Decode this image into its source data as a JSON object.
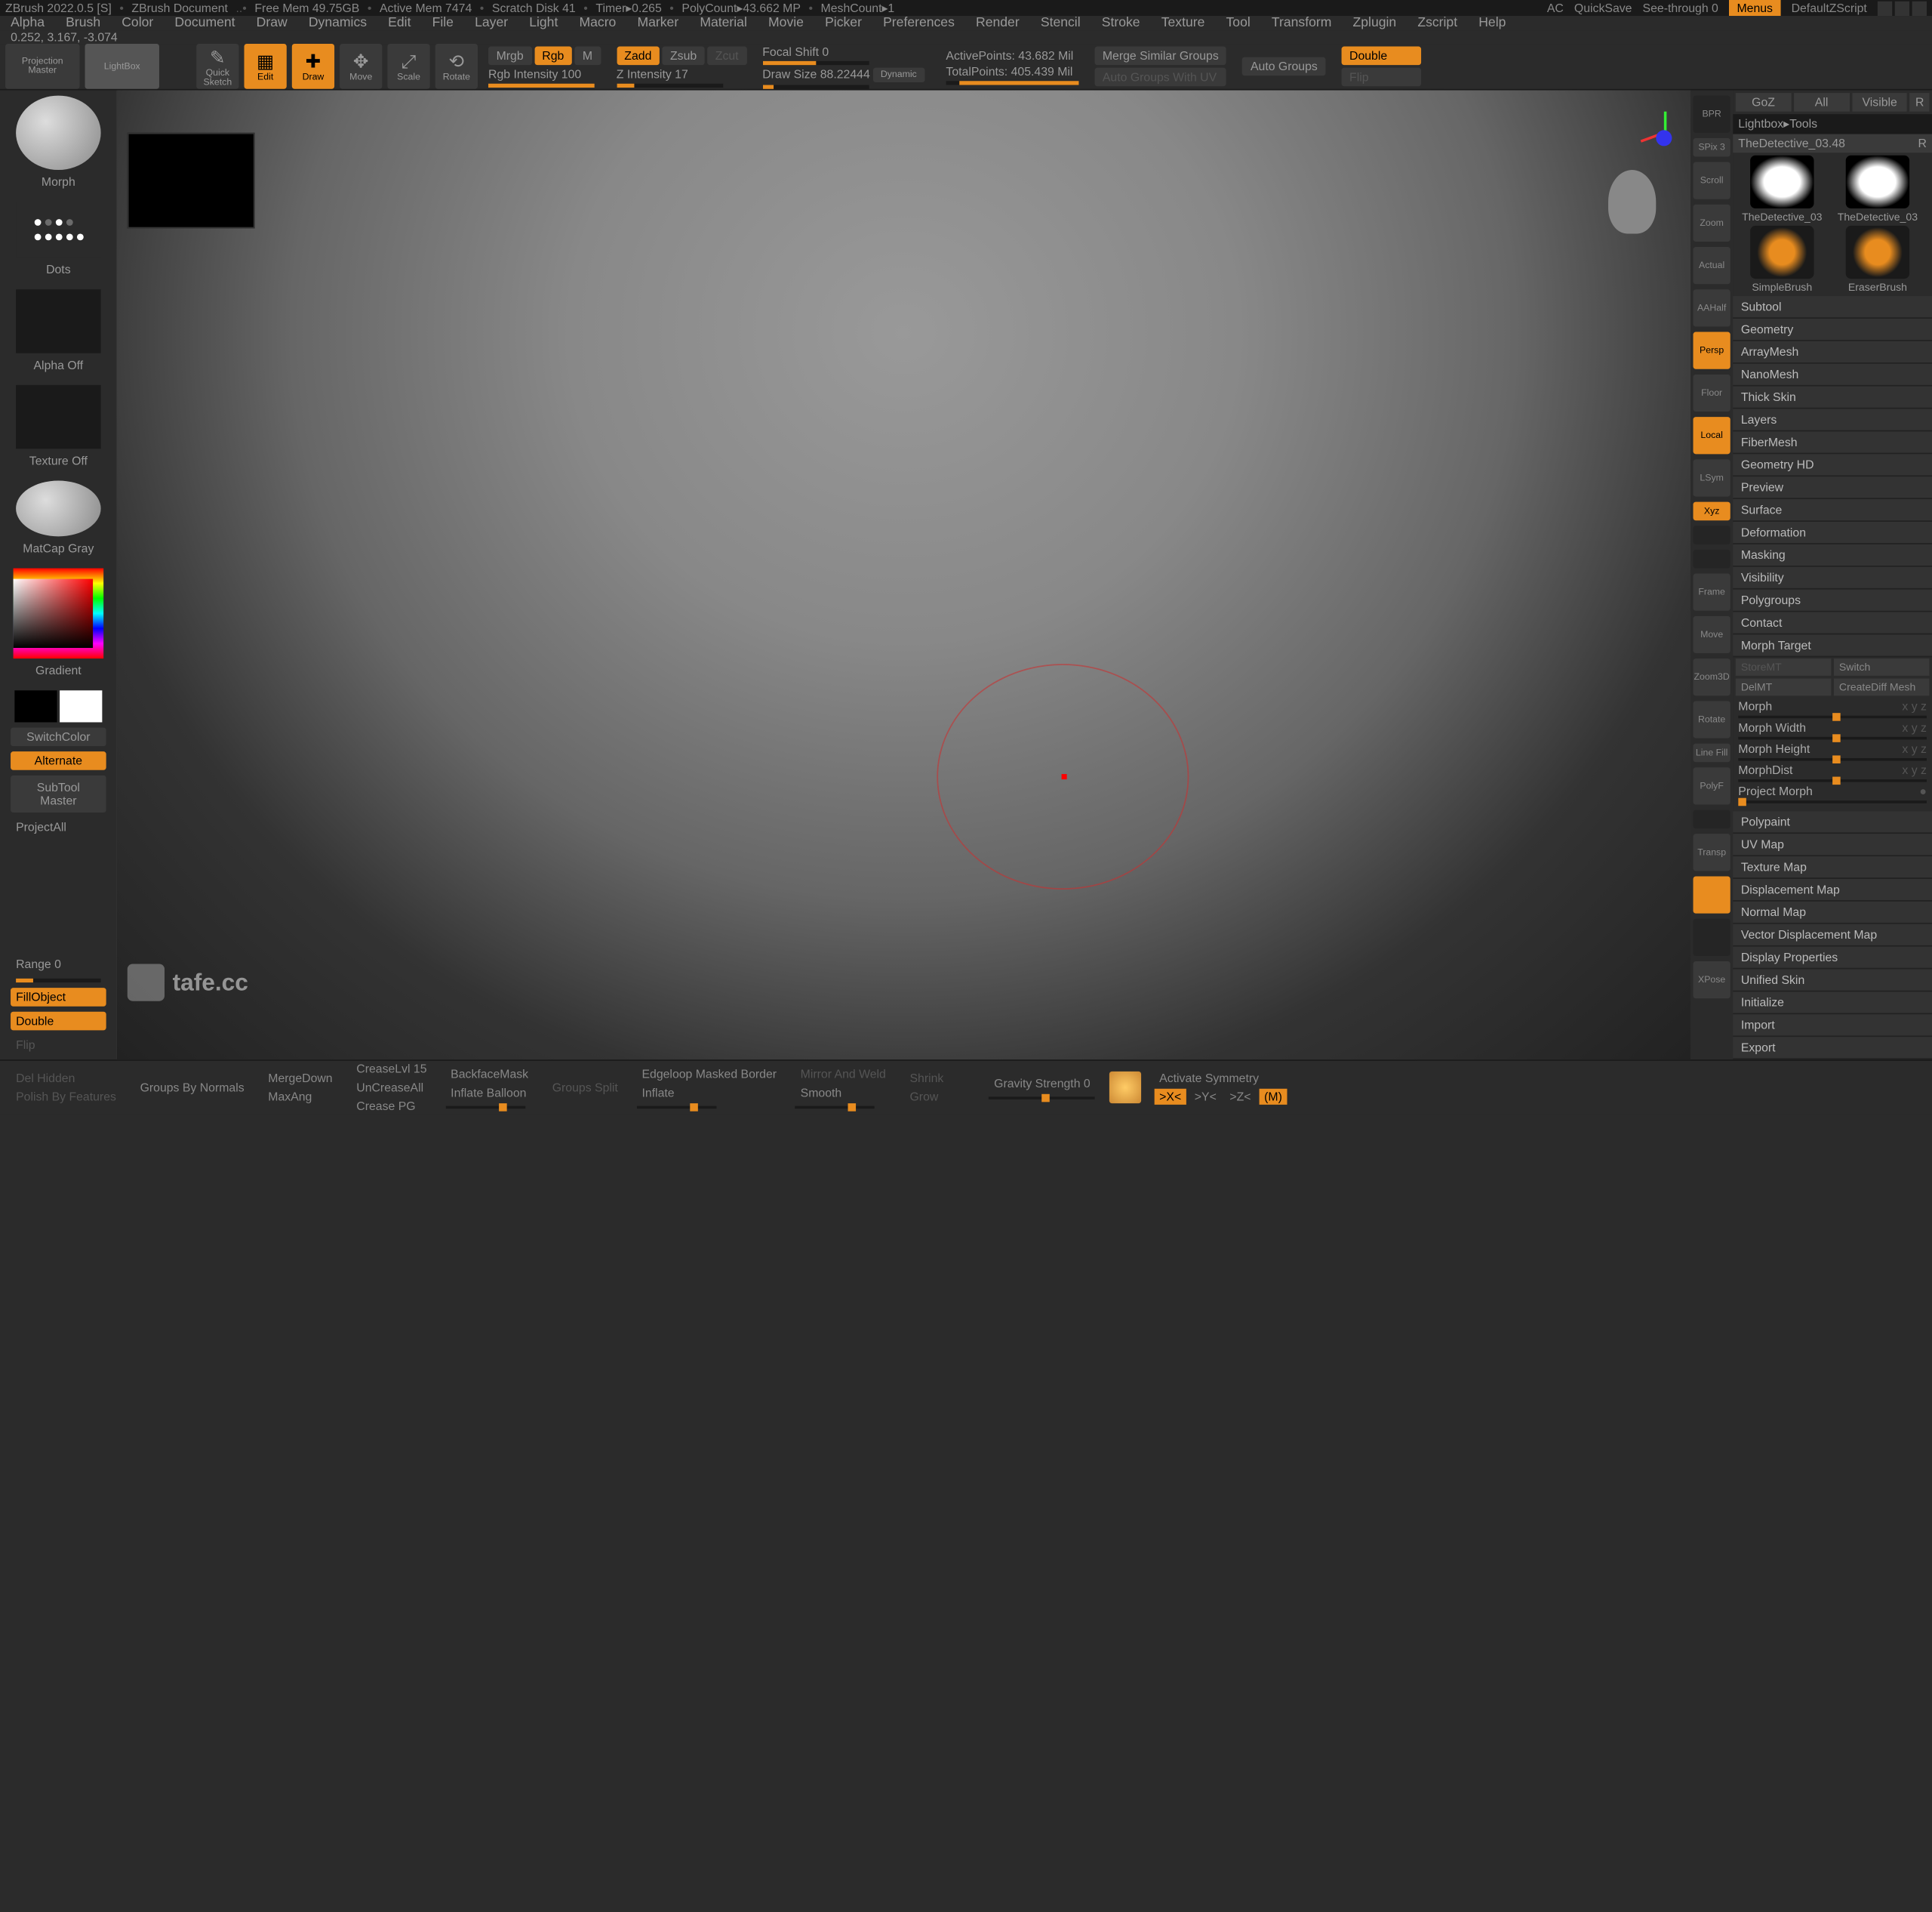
{
  "title": {
    "app": "ZBrush 2022.0.5 [S]",
    "doc": "ZBrush Document",
    "mem": "Free Mem 49.75GB",
    "active": "Active Mem 7474",
    "scratch": "Scratch Disk 41",
    "timer": "Timer▸0.265",
    "polycount": "PolyCount▸43.662 MP",
    "meshcount": "MeshCount▸1",
    "ac": "AC",
    "quicksave": "QuickSave",
    "seethrough": "See-through  0",
    "menus": "Menus",
    "zscript": "DefaultZScript"
  },
  "menubar": [
    "Alpha",
    "Brush",
    "Color",
    "Document",
    "Draw",
    "Dynamics",
    "Edit",
    "File",
    "Layer",
    "Light",
    "Macro",
    "Marker",
    "Material",
    "Movie",
    "Picker",
    "Preferences",
    "Render",
    "Stencil",
    "Stroke",
    "Texture",
    "Tool",
    "Transform",
    "Zplugin",
    "Zscript",
    "Help"
  ],
  "status_coords": "0.252, 3.167, -3.074",
  "toolbar": {
    "projection": "Projection\nMaster",
    "lightbox": "LightBox",
    "quicksketch": "Quick\nSketch",
    "edit": "Edit",
    "draw": "Draw",
    "move": "Move",
    "scale": "Scale",
    "rotate": "Rotate",
    "mrgb": "Mrgb",
    "rgb": "Rgb",
    "m": "M",
    "zadd": "Zadd",
    "zsub": "Zsub",
    "zcut": "Zcut",
    "rgb_intensity": "Rgb Intensity 100",
    "z_intensity": "Z Intensity 17",
    "focal_shift": "Focal Shift 0",
    "draw_size": "Draw Size 88.22444",
    "dynamic": "Dynamic",
    "active_points": "ActivePoints: 43.682 Mil",
    "total_points": "TotalPoints: 405.439 Mil",
    "merge_groups": "Merge Similar Groups",
    "auto_uv": "Auto Groups With UV",
    "auto_groups": "Auto Groups",
    "double": "Double",
    "flip": "Flip"
  },
  "left": {
    "morph": "Morph",
    "dots": "Dots",
    "alpha_off": "Alpha Off",
    "texture_off": "Texture Off",
    "matcap": "MatCap Gray",
    "gradient": "Gradient",
    "switch": "SwitchColor",
    "alternate": "Alternate",
    "subtool": "SubTool\nMaster",
    "projectall": "ProjectAll",
    "range": "Range 0",
    "fillobject": "FillObject",
    "double2": "Double",
    "flip2": "Flip"
  },
  "righttools": [
    "BPR",
    "SPix 3",
    "Scroll",
    "Zoom",
    "Actual",
    "AAHalf",
    "Persp",
    "Floor",
    "Local",
    "LSym",
    "Xyz",
    "",
    "",
    "Frame",
    "Move",
    "Zoom3D",
    "Rotate",
    "Line Fill",
    "PolyF",
    "",
    "Transp",
    "",
    "",
    "XPose"
  ],
  "rp": {
    "tabs": [
      "GoZ",
      "All",
      "Visible",
      "R"
    ],
    "breadcrumb": "Lightbox▸Tools",
    "toolname": "TheDetective_03.48",
    "r": "R",
    "thumbs": [
      "TheDetective_03",
      "TheDetective_03",
      "SimpleBrush",
      "EraserBrush"
    ],
    "sections": [
      "Subtool",
      "Geometry",
      "ArrayMesh",
      "NanoMesh",
      "Thick Skin",
      "Layers",
      "FiberMesh",
      "Geometry HD",
      "Preview",
      "Surface",
      "Deformation",
      "Masking",
      "Visibility",
      "Polygroups",
      "Contact",
      "Morph Target"
    ],
    "morph_buttons": {
      "storemt": "StoreMT",
      "switch": "Switch",
      "delmt": "DelMT",
      "creatediff": "CreateDiff Mesh"
    },
    "morph_sliders": [
      "Morph",
      "Morph Width",
      "Morph Height",
      "MorphDist",
      "Project Morph"
    ],
    "sections2": [
      "Polypaint",
      "UV Map",
      "Texture Map",
      "Displacement Map",
      "Normal Map",
      "Vector Displacement Map",
      "Display Properties",
      "Unified Skin",
      "Initialize",
      "Import",
      "Export"
    ]
  },
  "bottom": {
    "del_hidden": "Del Hidden",
    "groups_normals": "Groups By Normals",
    "polish_features": "Polish By Features",
    "mergedown": "MergeDown",
    "maxangle": "MaxAng",
    "crease_lvl": "CreaseLvl 15",
    "uncrease": "UnCreaseAll",
    "crease_pg": "Crease PG",
    "backface": "BackfaceMask",
    "groups_split": "Groups Split",
    "inflate_balloon": "Inflate Balloon",
    "edgeloop": "Edgeloop Masked Border",
    "inflate": "Inflate",
    "mirror_weld": "Mirror And Weld",
    "smooth": "Smooth",
    "shrink": "Shrink",
    "grow": "Grow",
    "gravity": "Gravity Strength 0",
    "activate_sym": "Activate Symmetry",
    "sym_x": ">X<",
    "sym_y": ">Y<",
    "sym_z": ">Z<",
    "sym_m": "(M)"
  },
  "watermark": "tafe.cc"
}
